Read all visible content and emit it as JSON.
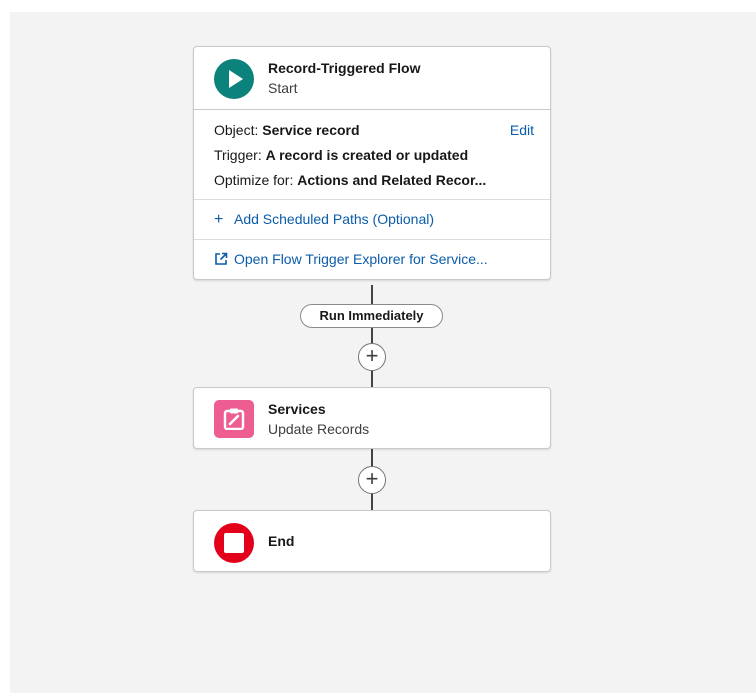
{
  "start_card": {
    "title": "Record-Triggered Flow",
    "subtitle": "Start",
    "object_label": "Object:",
    "object_value": "Service record",
    "edit_label": "Edit",
    "trigger_label": "Trigger:",
    "trigger_value": "A record is created or updated",
    "optimize_label": "Optimize for:",
    "optimize_value": "Actions and Related Recor...",
    "add_paths_label": "Add Scheduled Paths (Optional)",
    "explorer_label": "Open Flow Trigger Explorer for Service..."
  },
  "path_label": "Run Immediately",
  "update_card": {
    "title": "Services",
    "subtitle": "Update Records"
  },
  "end_card": {
    "title": "End"
  },
  "icons": {
    "start": "play-icon",
    "update": "update-records-icon",
    "end": "stop-icon",
    "add": "plus-icon",
    "explorer": "external-link-icon"
  },
  "colors": {
    "start": "#0b827c",
    "update": "#ee5d91",
    "end": "#e3001b",
    "link": "#0b5cab"
  }
}
